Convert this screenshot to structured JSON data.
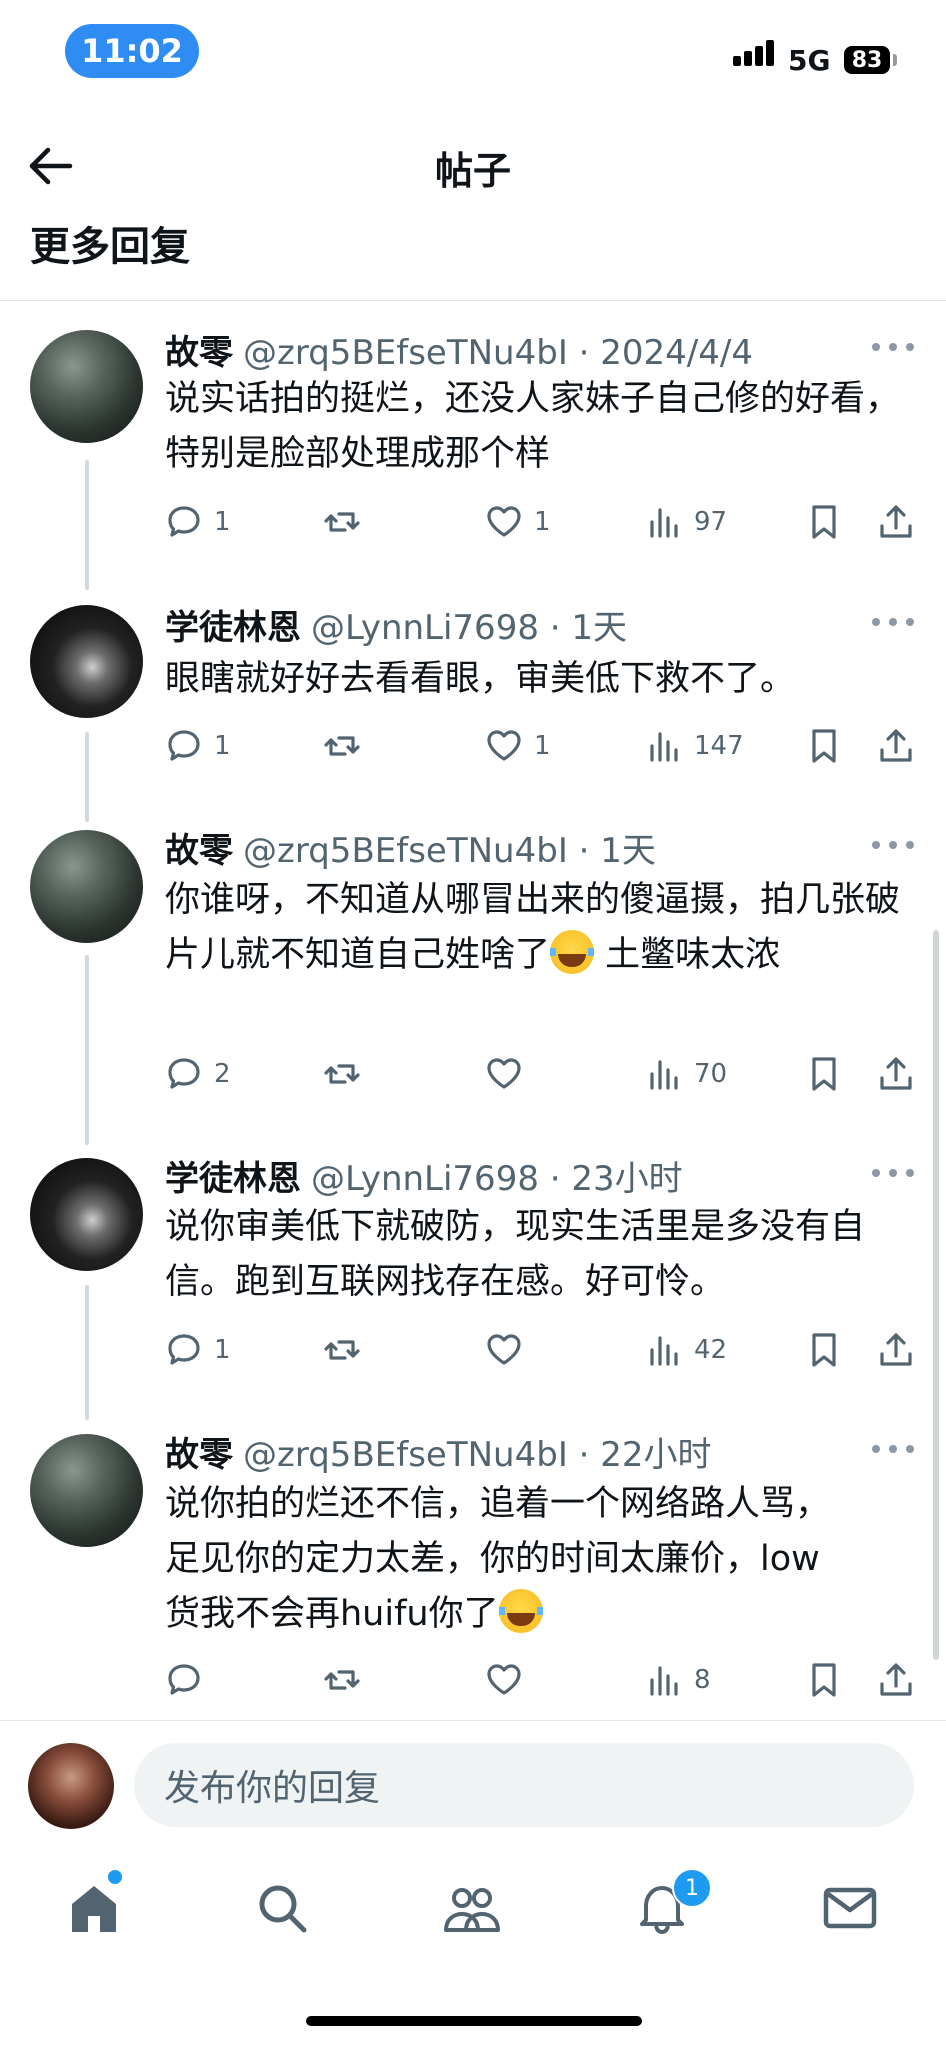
{
  "status_bar": {
    "time": "11:02",
    "network": "5G",
    "battery": "83"
  },
  "header": {
    "title": "帖子",
    "section": "更多回复"
  },
  "comments": [
    {
      "name": "故零",
      "handle": "@zrq5BEfseTNu4bI",
      "time": "2024/4/4",
      "text": "说实话拍的挺烂，还没人家妹子自己修的好看，特别是脸部处理成那个样",
      "replies": "1",
      "retweets": "",
      "likes": "1",
      "views": "97"
    },
    {
      "name": "学徒林恩",
      "handle": "@LynnLi7698",
      "time": "1天",
      "text": "眼瞎就好好去看看眼，审美低下救不了。",
      "replies": "1",
      "retweets": "",
      "likes": "1",
      "views": "147"
    },
    {
      "name": "故零",
      "handle": "@zrq5BEfseTNu4bI",
      "time": "1天",
      "text_before_emoji": "你谁呀，不知道从哪冒出来的傻逼摄，拍几张破片儿就不知道自己姓啥了",
      "text_after_emoji": " 土鳖味太浓",
      "replies": "2",
      "retweets": "",
      "likes": "",
      "views": "70"
    },
    {
      "name": "学徒林恩",
      "handle": "@LynnLi7698",
      "time": "23小时",
      "text": "说你审美低下就破防，现实生活里是多没有自信。跑到互联网找存在感。好可怜。",
      "replies": "1",
      "retweets": "",
      "likes": "",
      "views": "42"
    },
    {
      "name": "故零",
      "handle": "@zrq5BEfseTNu4bI",
      "time": "22小时",
      "text_before_emoji": "说你拍的烂还不信，追着一个网络路人骂，足见你的定力太差，你的时间太廉价，low货我不会再huifu你了",
      "text_after_emoji": "",
      "replies": "",
      "retweets": "",
      "likes": "",
      "views": "8"
    }
  ],
  "reply_bar": {
    "placeholder": "发布你的回复"
  },
  "tab_bar": {
    "notifications_badge": "1"
  },
  "colors": {
    "accent": "#1d9bf0",
    "time_pill": "#2f8cf3",
    "muted": "#536471"
  },
  "icons": [
    "back-arrow-icon",
    "more-dots-icon",
    "reply-icon",
    "retweet-icon",
    "like-icon",
    "views-icon",
    "bookmark-icon",
    "share-icon",
    "home-icon",
    "search-icon",
    "communities-icon",
    "notifications-icon",
    "messages-icon",
    "laughing-emoji"
  ]
}
